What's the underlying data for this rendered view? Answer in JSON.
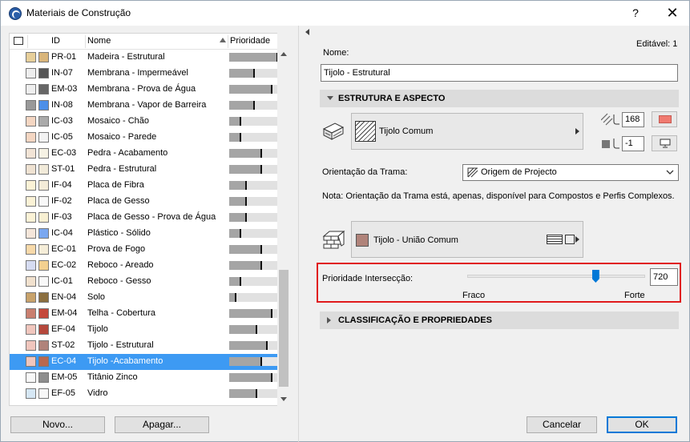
{
  "window": {
    "title": "Materiais de Construção",
    "help_label": "?",
    "close_label": "✕"
  },
  "list": {
    "headers": {
      "id": "ID",
      "name": "Nome",
      "priority": "Prioridade"
    },
    "selected_index": 19,
    "rows": [
      {
        "id": "PR-01",
        "name": "Madeira - Estrutural",
        "priority": 0.92,
        "sw1": "#e7cf9a",
        "sw2": "#d9b57a"
      },
      {
        "id": "IN-07",
        "name": "Membrana - Impermeável",
        "priority": 0.47,
        "sw1": "#eeeeee",
        "sw2": "#555555"
      },
      {
        "id": "EM-03",
        "name": "Membrana - Prova de Água",
        "priority": 0.82,
        "sw1": "#eeeeee",
        "sw2": "#666666"
      },
      {
        "id": "IN-08",
        "name": "Membrana - Vapor de Barreira",
        "priority": 0.47,
        "sw1": "#999999",
        "sw2": "#4d8fe8"
      },
      {
        "id": "IC-03",
        "name": "Mosaico - Chão",
        "priority": 0.22,
        "sw1": "#f4d6c2",
        "sw2": "#aaaaaa"
      },
      {
        "id": "IC-05",
        "name": "Mosaico - Parede",
        "priority": 0.22,
        "sw1": "#f4d6c2",
        "sw2": "#f3f3f3"
      },
      {
        "id": "EC-03",
        "name": "Pedra - Acabamento",
        "priority": 0.62,
        "sw1": "#f2e4d6",
        "sw2": "#f6f2e4"
      },
      {
        "id": "ST-01",
        "name": "Pedra - Estrutural",
        "priority": 0.62,
        "sw1": "#efe2d2",
        "sw2": "#f1ead9"
      },
      {
        "id": "IF-04",
        "name": "Placa de Fibra",
        "priority": 0.32,
        "sw1": "#fbf2d6",
        "sw2": "#f4ecd8"
      },
      {
        "id": "IF-02",
        "name": "Placa de Gesso",
        "priority": 0.32,
        "sw1": "#fbf2d6",
        "sw2": "#f8f8f8"
      },
      {
        "id": "IF-03",
        "name": "Placa de Gesso - Prova de Água",
        "priority": 0.32,
        "sw1": "#fbf2d6",
        "sw2": "#f8f0d2"
      },
      {
        "id": "IC-04",
        "name": "Plástico - Sólido",
        "priority": 0.22,
        "sw1": "#f5e6da",
        "sw2": "#7aa7f0"
      },
      {
        "id": "EC-01",
        "name": "Prova de Fogo",
        "priority": 0.62,
        "sw1": "#f7d9a9",
        "sw2": "#f5edd8"
      },
      {
        "id": "EC-02",
        "name": "Reboco - Areado",
        "priority": 0.62,
        "sw1": "#d6dcf2",
        "sw2": "#f3d08f"
      },
      {
        "id": "IC-01",
        "name": "Reboco - Gesso",
        "priority": 0.22,
        "sw1": "#f1e1ce",
        "sw2": "#f8f8f8"
      },
      {
        "id": "EN-04",
        "name": "Solo",
        "priority": 0.12,
        "sw1": "#c8a26b",
        "sw2": "#8a6e3f"
      },
      {
        "id": "EM-04",
        "name": "Telha - Cobertura",
        "priority": 0.82,
        "sw1": "#c97f6f",
        "sw2": "#c4483b"
      },
      {
        "id": "EF-04",
        "name": "Tijolo",
        "priority": 0.52,
        "sw1": "#f0c6bd",
        "sw2": "#b5473b"
      },
      {
        "id": "ST-02",
        "name": "Tijolo - Estrutural",
        "priority": 0.72,
        "sw1": "#f0c6bd",
        "sw2": "#b0837a"
      },
      {
        "id": "EC-04",
        "name": "Tijolo -Acabamento",
        "priority": 0.62,
        "sw1": "#f0c6bd",
        "sw2": "#b9684f"
      },
      {
        "id": "EM-05",
        "name": "Titânio Zinco",
        "priority": 0.82,
        "sw1": "#f8f8f8",
        "sw2": "#8e8e8e"
      },
      {
        "id": "EF-05",
        "name": "Vidro",
        "priority": 0.52,
        "sw1": "#d6e7f4",
        "sw2": "#f8f8f8"
      }
    ]
  },
  "buttons": {
    "new": "Novo...",
    "delete": "Apagar...",
    "cancel": "Cancelar",
    "ok": "OK"
  },
  "editable": "Editável: 1",
  "name_label": "Nome:",
  "name_value": "Tijolo - Estrutural",
  "section_structure": "ESTRUTURA E ASPECTO",
  "surface": {
    "name": "Tijolo Comum",
    "pen_value": "168",
    "bg_value": "-1",
    "pen_color": "#f07a70"
  },
  "orientation": {
    "label": "Orientação da Trama:",
    "value": "Origem de Projecto"
  },
  "note": "Nota: Orientação da Trama está, apenas, disponível para Compostos e Perfis Complexos.",
  "cut_fill": {
    "name": "Tijolo - União Comum",
    "swatch": "#b0837a"
  },
  "priority": {
    "label": "Prioridade Intersecção:",
    "value": "720",
    "level": 0.72,
    "weak": "Fraco",
    "strong": "Forte"
  },
  "section_classification": "CLASSIFICAÇÃO E PROPRIEDADES"
}
